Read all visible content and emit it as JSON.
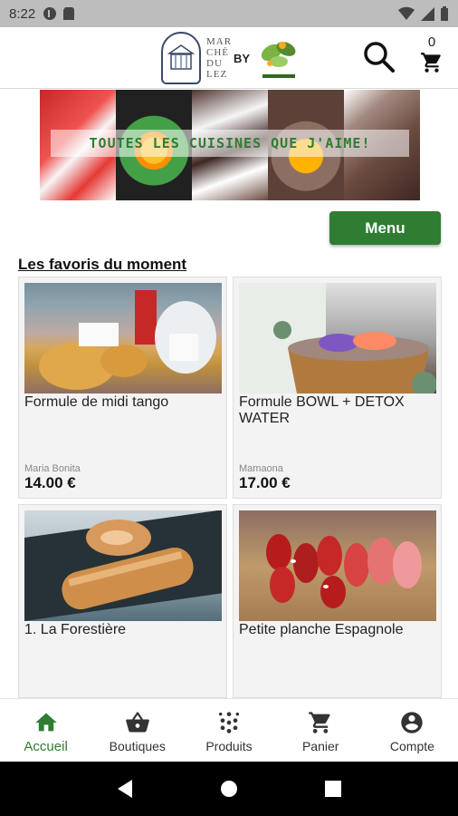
{
  "status_bar": {
    "time": "8:22"
  },
  "header": {
    "logo_text": "MAR CHÉ DU LEZ",
    "logo_by": "BY",
    "cart_count": "0"
  },
  "banner": {
    "text": "TOUTES LES CUISINES QUE J'AIME!"
  },
  "menu_button": {
    "label": "Menu"
  },
  "section": {
    "title": "Les favoris du moment"
  },
  "products": [
    {
      "name": "Formule de midi tango",
      "vendor": "Maria Bonita",
      "price": "14.00 €"
    },
    {
      "name": "Formule BOWL + DETOX WATER",
      "vendor": "Mamaona",
      "price": "17.00 €"
    },
    {
      "name": "1. La Forestière",
      "vendor": "",
      "price": ""
    },
    {
      "name": "Petite planche Espagnole",
      "vendor": "",
      "price": ""
    }
  ],
  "bottom_nav": [
    {
      "label": "Accueil",
      "icon": "home-icon",
      "active": true
    },
    {
      "label": "Boutiques",
      "icon": "basket-icon",
      "active": false
    },
    {
      "label": "Produits",
      "icon": "grid-dots-icon",
      "active": false
    },
    {
      "label": "Panier",
      "icon": "cart-icon",
      "active": false
    },
    {
      "label": "Compte",
      "icon": "account-icon",
      "active": false
    }
  ],
  "colors": {
    "accent": "#2e7d32",
    "status_bar": "#bdbdbd",
    "card_bg": "#f3f3f3"
  }
}
